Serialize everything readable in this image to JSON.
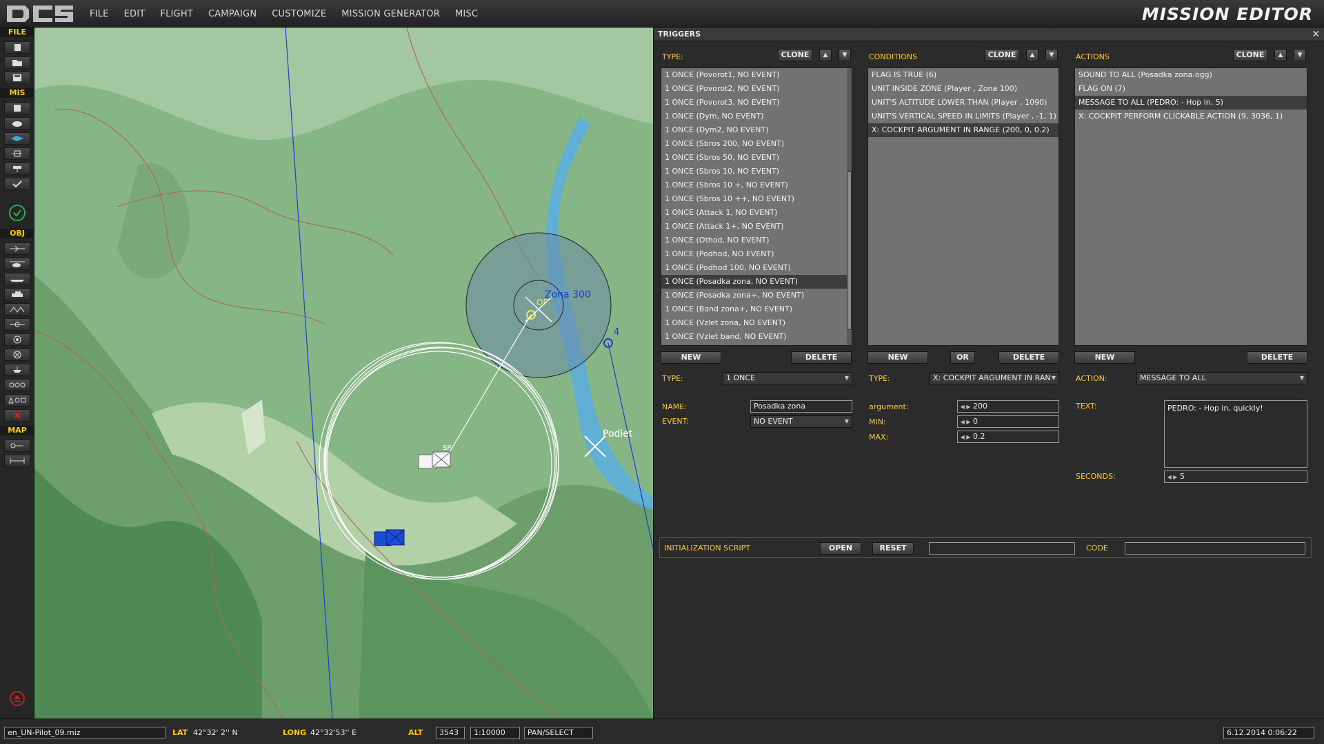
{
  "menu": [
    "FILE",
    "EDIT",
    "FLIGHT",
    "CAMPAIGN",
    "CUSTOMIZE",
    "MISSION GENERATOR",
    "MISC"
  ],
  "app_title": "MISSION EDITOR",
  "toolbar": {
    "sections": {
      "file": "FILE",
      "mis": "MIS",
      "obj": "OBJ",
      "map": "MAP"
    }
  },
  "map": {
    "labels": {
      "zone": "Zona 300",
      "op": "OP",
      "waypoint": "4",
      "podlet": "Podlet",
      "sp": "SP"
    }
  },
  "triggers": {
    "title": "TRIGGERS",
    "type_label": "TYPE:",
    "clone": "CLONE",
    "items": [
      "1 ONCE (Povorot1, NO EVENT)",
      "1 ONCE (Povorot2, NO EVENT)",
      "1 ONCE (Povorot3, NO EVENT)",
      "1 ONCE (Dym, NO EVENT)",
      "1 ONCE (Dym2, NO EVENT)",
      "1 ONCE (Sbros 200, NO EVENT)",
      "1 ONCE (Sbros 50, NO EVENT)",
      "1 ONCE (Sbros 10, NO EVENT)",
      "1 ONCE (Sbros 10 +, NO EVENT)",
      "1 ONCE (Sbros 10 ++, NO EVENT)",
      "1 ONCE (Attack 1, NO EVENT)",
      "1 ONCE (Attack 1+, NO EVENT)",
      "1 ONCE (Othod, NO EVENT)",
      "1 ONCE (Podhod, NO EVENT)",
      "1 ONCE (Podhod 100, NO EVENT)",
      "1 ONCE (Posadka zona, NO EVENT)",
      "1 ONCE (Posadka zona+, NO EVENT)",
      "1 ONCE (Band zona+, NO EVENT)",
      "1 ONCE (Vzlet zona, NO EVENT)",
      "1 ONCE (Vzlet band, NO EVENT)"
    ],
    "selected_index": 15,
    "new": "NEW",
    "delete": "DELETE",
    "type_value": "1 ONCE",
    "name_label": "NAME:",
    "name_value": "Posadka zona",
    "event_label": "EVENT:",
    "event_value": "NO EVENT"
  },
  "conditions": {
    "title": "CONDITIONS",
    "clone": "CLONE",
    "items": [
      "FLAG IS TRUE (6)",
      "UNIT INSIDE ZONE (Player , Zona 100)",
      "UNIT'S ALTITUDE LOWER THAN (Player , 1090)",
      "UNIT'S VERTICAL SPEED IN LIMITS (Player , -1, 1)",
      "X: COCKPIT ARGUMENT IN RANGE (200, 0, 0.2)"
    ],
    "selected_index": 4,
    "new": "NEW",
    "or": "OR",
    "delete": "DELETE",
    "type_label": "TYPE:",
    "type_value": "X: COCKPIT ARGUMENT IN RAN",
    "argument_label": "argument:",
    "argument_value": "200",
    "min_label": "MIN:",
    "min_value": "0",
    "max_label": "MAX:",
    "max_value": "0.2"
  },
  "actions": {
    "title": "ACTIONS",
    "clone": "CLONE",
    "items": [
      "SOUND TO ALL (Posadka zona.ogg)",
      "FLAG ON (7)",
      "MESSAGE TO ALL (PEDRO: - Hop in, 5)",
      "X: COCKPIT PERFORM CLICKABLE ACTION (9, 3036, 1)"
    ],
    "selected_index": 2,
    "new": "NEW",
    "delete": "DELETE",
    "action_label": "ACTION:",
    "action_value": "MESSAGE TO ALL",
    "text_label": "TEXT:",
    "text_value": "PEDRO: - Hop in, quickly!",
    "seconds_label": "SECONDS:",
    "seconds_value": "5"
  },
  "init": {
    "label": "INITIALIZATION SCRIPT",
    "open": "OPEN",
    "reset": "RESET",
    "code_label": "CODE"
  },
  "status": {
    "file": "en_UN-Pilot_09.miz",
    "lat_label": "LAT",
    "lat": "42°32' 2'' N",
    "long_label": "LONG",
    "long": "42°32'53'' E",
    "alt_label": "ALT",
    "alt": "3543",
    "scale": "1:10000",
    "mode": "PAN/SELECT",
    "datetime": "6.12.2014 0:06:22"
  }
}
